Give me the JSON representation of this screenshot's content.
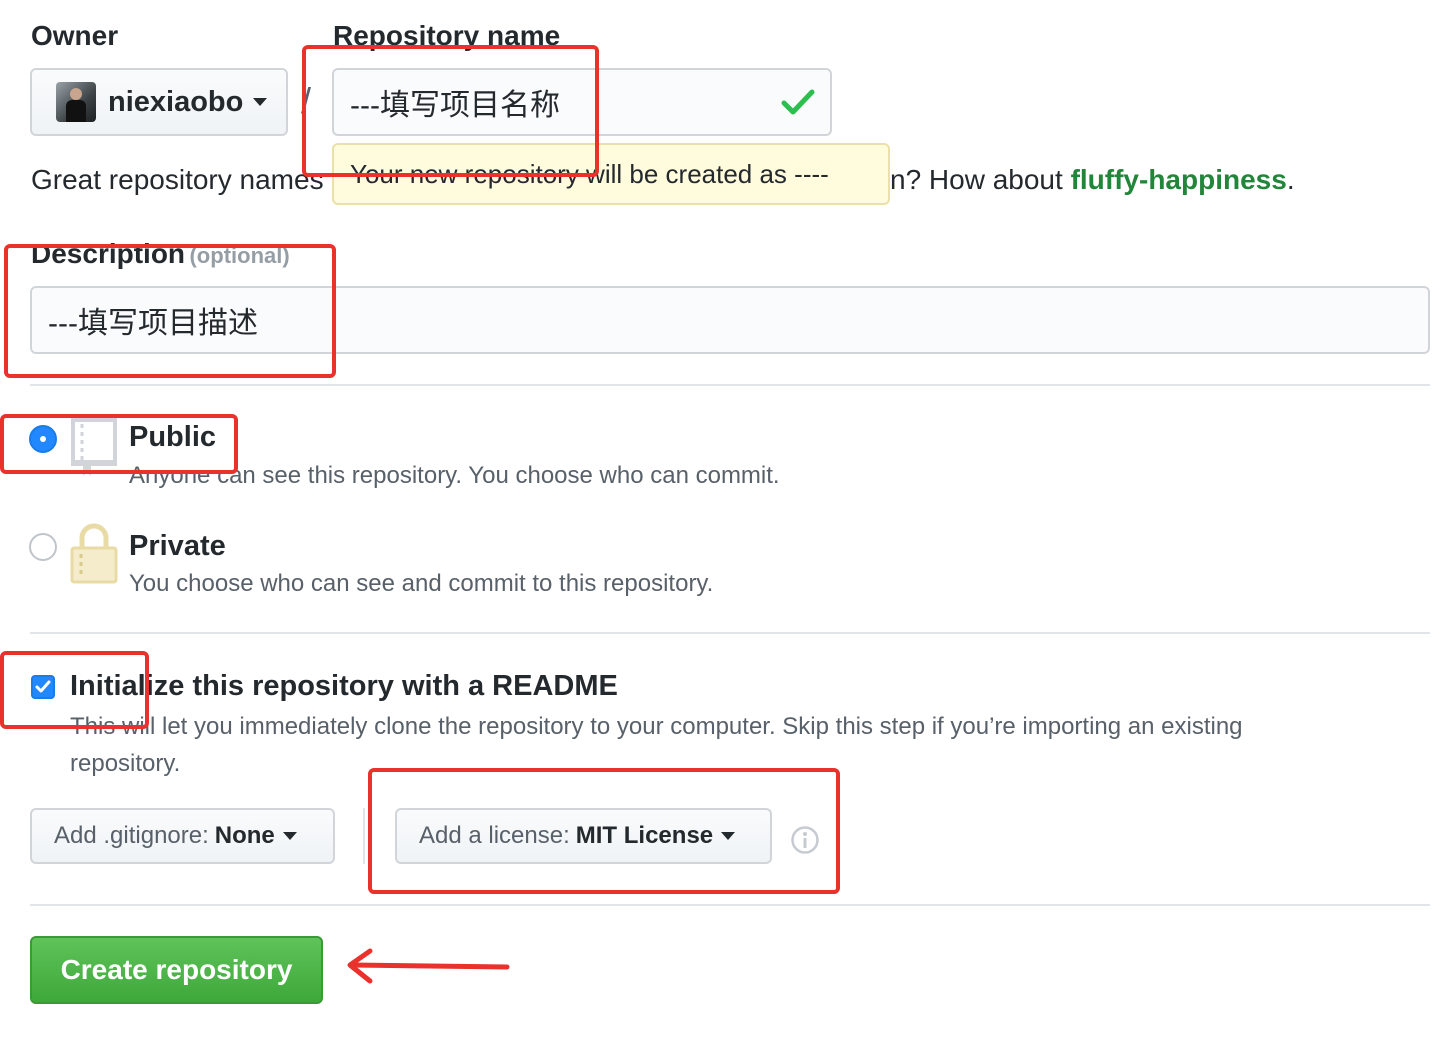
{
  "owner": {
    "label": "Owner",
    "username": "niexiaobo"
  },
  "separator": "/",
  "repo_name": {
    "label": "Repository name",
    "value": "---填写项目名称"
  },
  "tooltip": {
    "text": "Your new repository will be created as ----"
  },
  "suggestion": {
    "prefix": "Great repository names",
    "middle": "n? How about ",
    "suggested_name": "fluffy-happiness",
    "suffix": "."
  },
  "description": {
    "label": "Description",
    "optional": "(optional)",
    "value": "---填写项目描述"
  },
  "visibility": {
    "public": {
      "title": "Public",
      "text": "Anyone can see this repository. You choose who can commit.",
      "selected": true
    },
    "private": {
      "title": "Private",
      "text": "You choose who can see and commit to this repository.",
      "selected": false
    }
  },
  "readme": {
    "title": "Initialize this repository with a README",
    "text_line1": "This will let you immediately clone the repository to your computer. Skip this step if you’re importing an existing",
    "text_line2": "repository.",
    "checked": true
  },
  "gitignore": {
    "prefix": "Add .gitignore: ",
    "value": "None"
  },
  "license": {
    "prefix": "Add a license: ",
    "value": "MIT License"
  },
  "create_button": "Create repository",
  "colors": {
    "annotation_red": "#e8322b",
    "create_green": "#28a745",
    "check_green": "#2cbe4e",
    "radio_blue": "#2188ff",
    "suggest_green": "#22863a",
    "tooltip_bg": "#fffbdd"
  }
}
